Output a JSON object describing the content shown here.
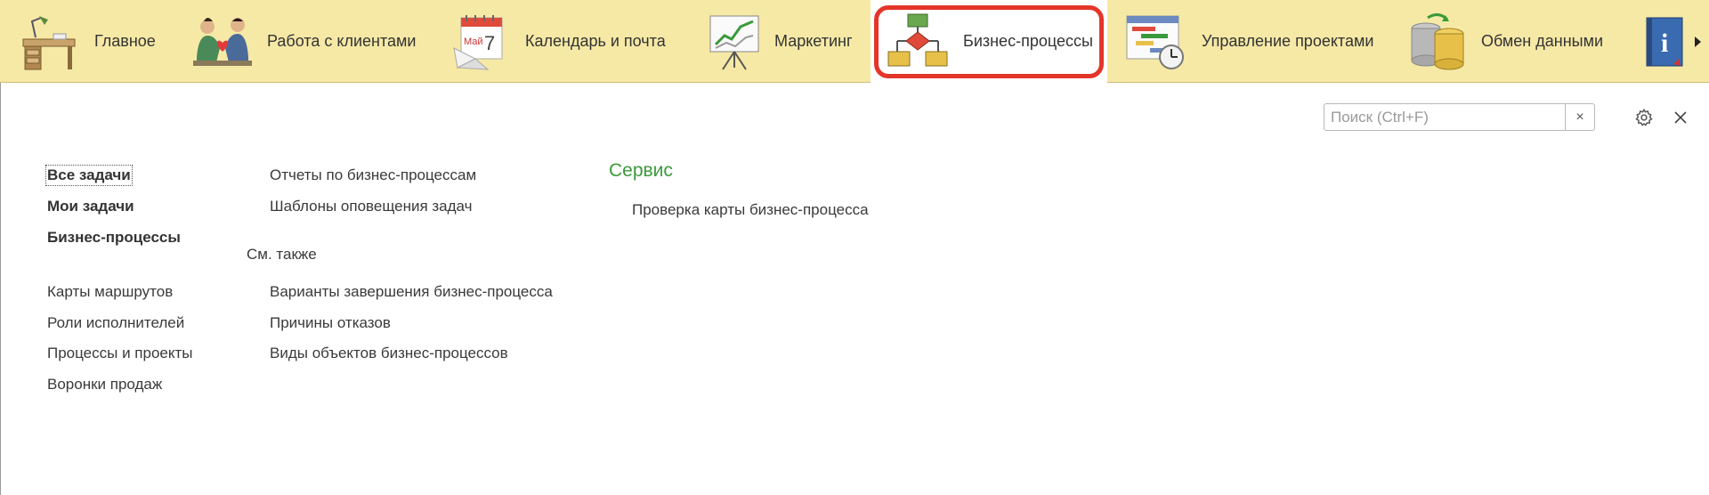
{
  "topbar": {
    "sections": [
      {
        "label": "Главное",
        "icon": "desk-icon"
      },
      {
        "label": "Работа с клиентами",
        "icon": "handshake-icon"
      },
      {
        "label": "Календарь и почта",
        "icon": "calendar-icon",
        "icon_text": "Май 7"
      },
      {
        "label": "Маркетинг",
        "icon": "chart-board-icon"
      },
      {
        "label": "Бизнес-процессы",
        "icon": "flowchart-icon",
        "active": true
      },
      {
        "label": "Управление проектами",
        "icon": "gantt-clock-icon"
      },
      {
        "label": "Обмен данными",
        "icon": "database-sync-icon"
      },
      {
        "label": "",
        "icon": "info-book-icon"
      }
    ],
    "scroll_arrow": "chevron-right-icon"
  },
  "toolbar": {
    "search_placeholder": "Поиск (Ctrl+F)",
    "search_value": "",
    "clear_label": "×",
    "settings_icon": "gear-icon",
    "close_icon": "close-icon"
  },
  "menu": {
    "col1_bold": [
      "Все задачи",
      "Мои задачи",
      "Бизнес-процессы"
    ],
    "col1": [
      "Карты маршрутов",
      "Роли исполнителей",
      "Процессы и проекты",
      "Воронки продаж"
    ],
    "col2_top": [
      "Отчеты по бизнес-процессам",
      "Шаблоны оповещения задач"
    ],
    "see_also_title": "См. также",
    "col2_see_also": [
      "Варианты завершения бизнес-процесса",
      "Причины отказов",
      "Виды объектов бизнес-процессов"
    ],
    "service_title": "Сервис",
    "service_items": [
      "Проверка карты бизнес-процесса"
    ]
  },
  "colors": {
    "topbar_bg": "#f6e9a6",
    "active_ring": "#e5352a",
    "service_heading": "#3b9a3b"
  }
}
